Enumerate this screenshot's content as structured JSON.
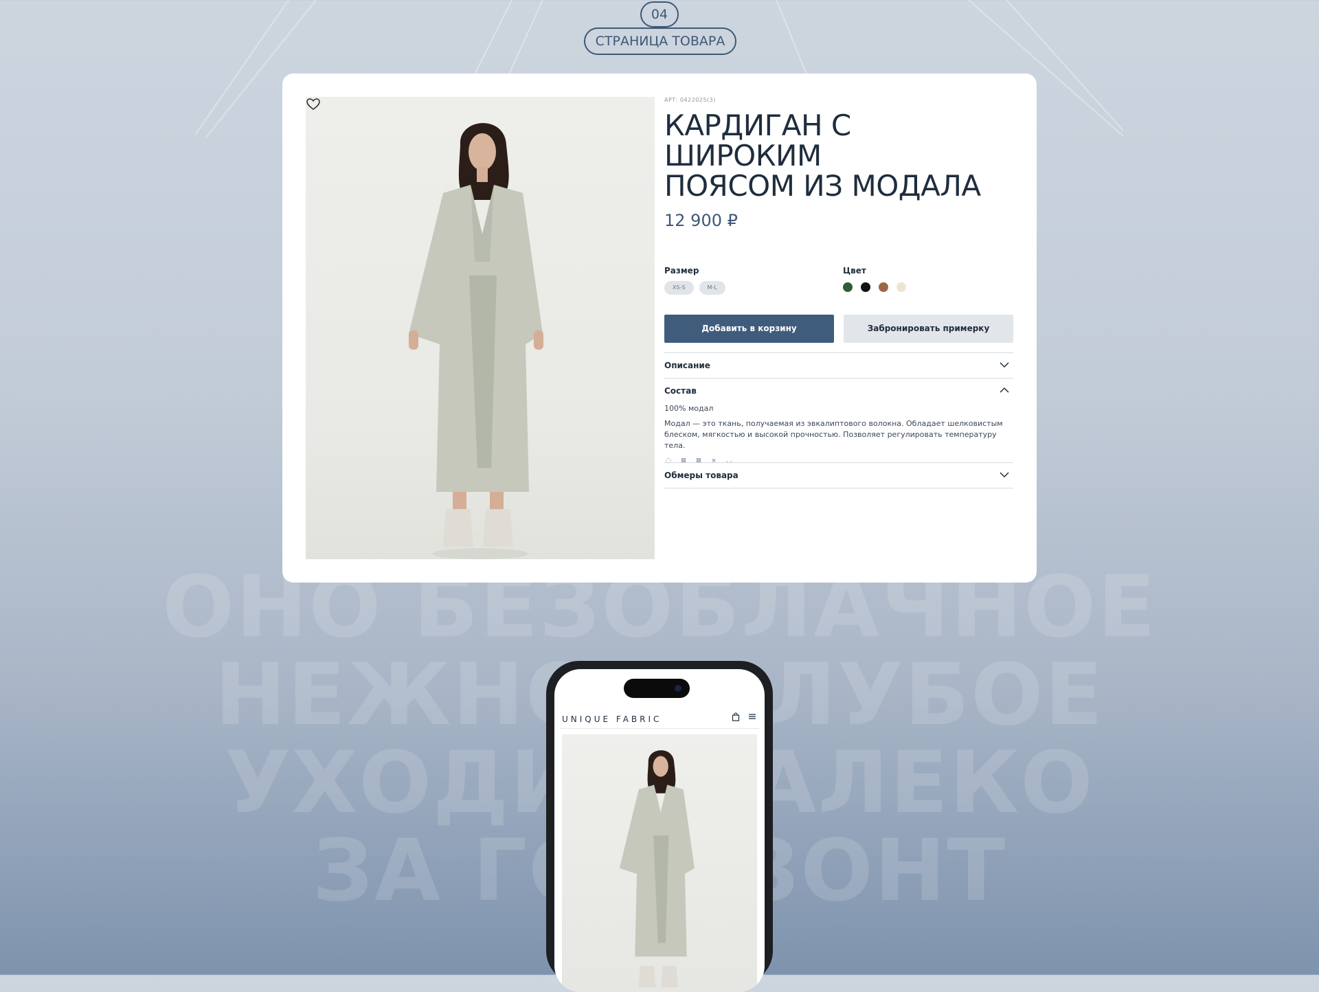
{
  "section": {
    "number": "04",
    "title": "СТРАНИЦА ТОВАРА"
  },
  "background_text": [
    "ОНО БЕЗОБЛАЧНОЕ",
    "НЕЖНО-ГОЛУБОЕ",
    "УХОДИТ ДАЛЕКО",
    "ЗА ГОРИЗОНТ"
  ],
  "product": {
    "article": "АРТ: 0422025(3)",
    "title_line1": "КАРДИГАН С ШИРОКИМ",
    "title_line2": "ПОЯСОМ ИЗ МОДАЛА",
    "price": "12 900 ₽",
    "size_label": "Размер",
    "sizes": [
      "XS-S",
      "M-L"
    ],
    "color_label": "Цвет",
    "colors": [
      "#2f5e36",
      "#111111",
      "#9c6748",
      "#efe3d3"
    ],
    "add_to_cart": "Добавить в корзину",
    "book_fitting": "Забронировать примерку",
    "accordion": {
      "description": "Описание",
      "composition": "Состав",
      "composition_value": "100% модал",
      "composition_text": "Модал — это ткань, получаемая из эвкалиптового волокна. Обладает шелковистым блеском, мягкостью и высокой прочностью. Позволяет регулировать температуру тела.",
      "care_icons": [
        "wash-30-icon",
        "no-bleach-icon",
        "no-tumble-dry-icon",
        "no-iron-icon",
        "dry-clean-icon"
      ],
      "measurements": "Обмеры товара"
    }
  },
  "mobile": {
    "logo": "UNIQUE FABRIC",
    "icons": [
      "bag-icon",
      "menu-icon"
    ]
  }
}
